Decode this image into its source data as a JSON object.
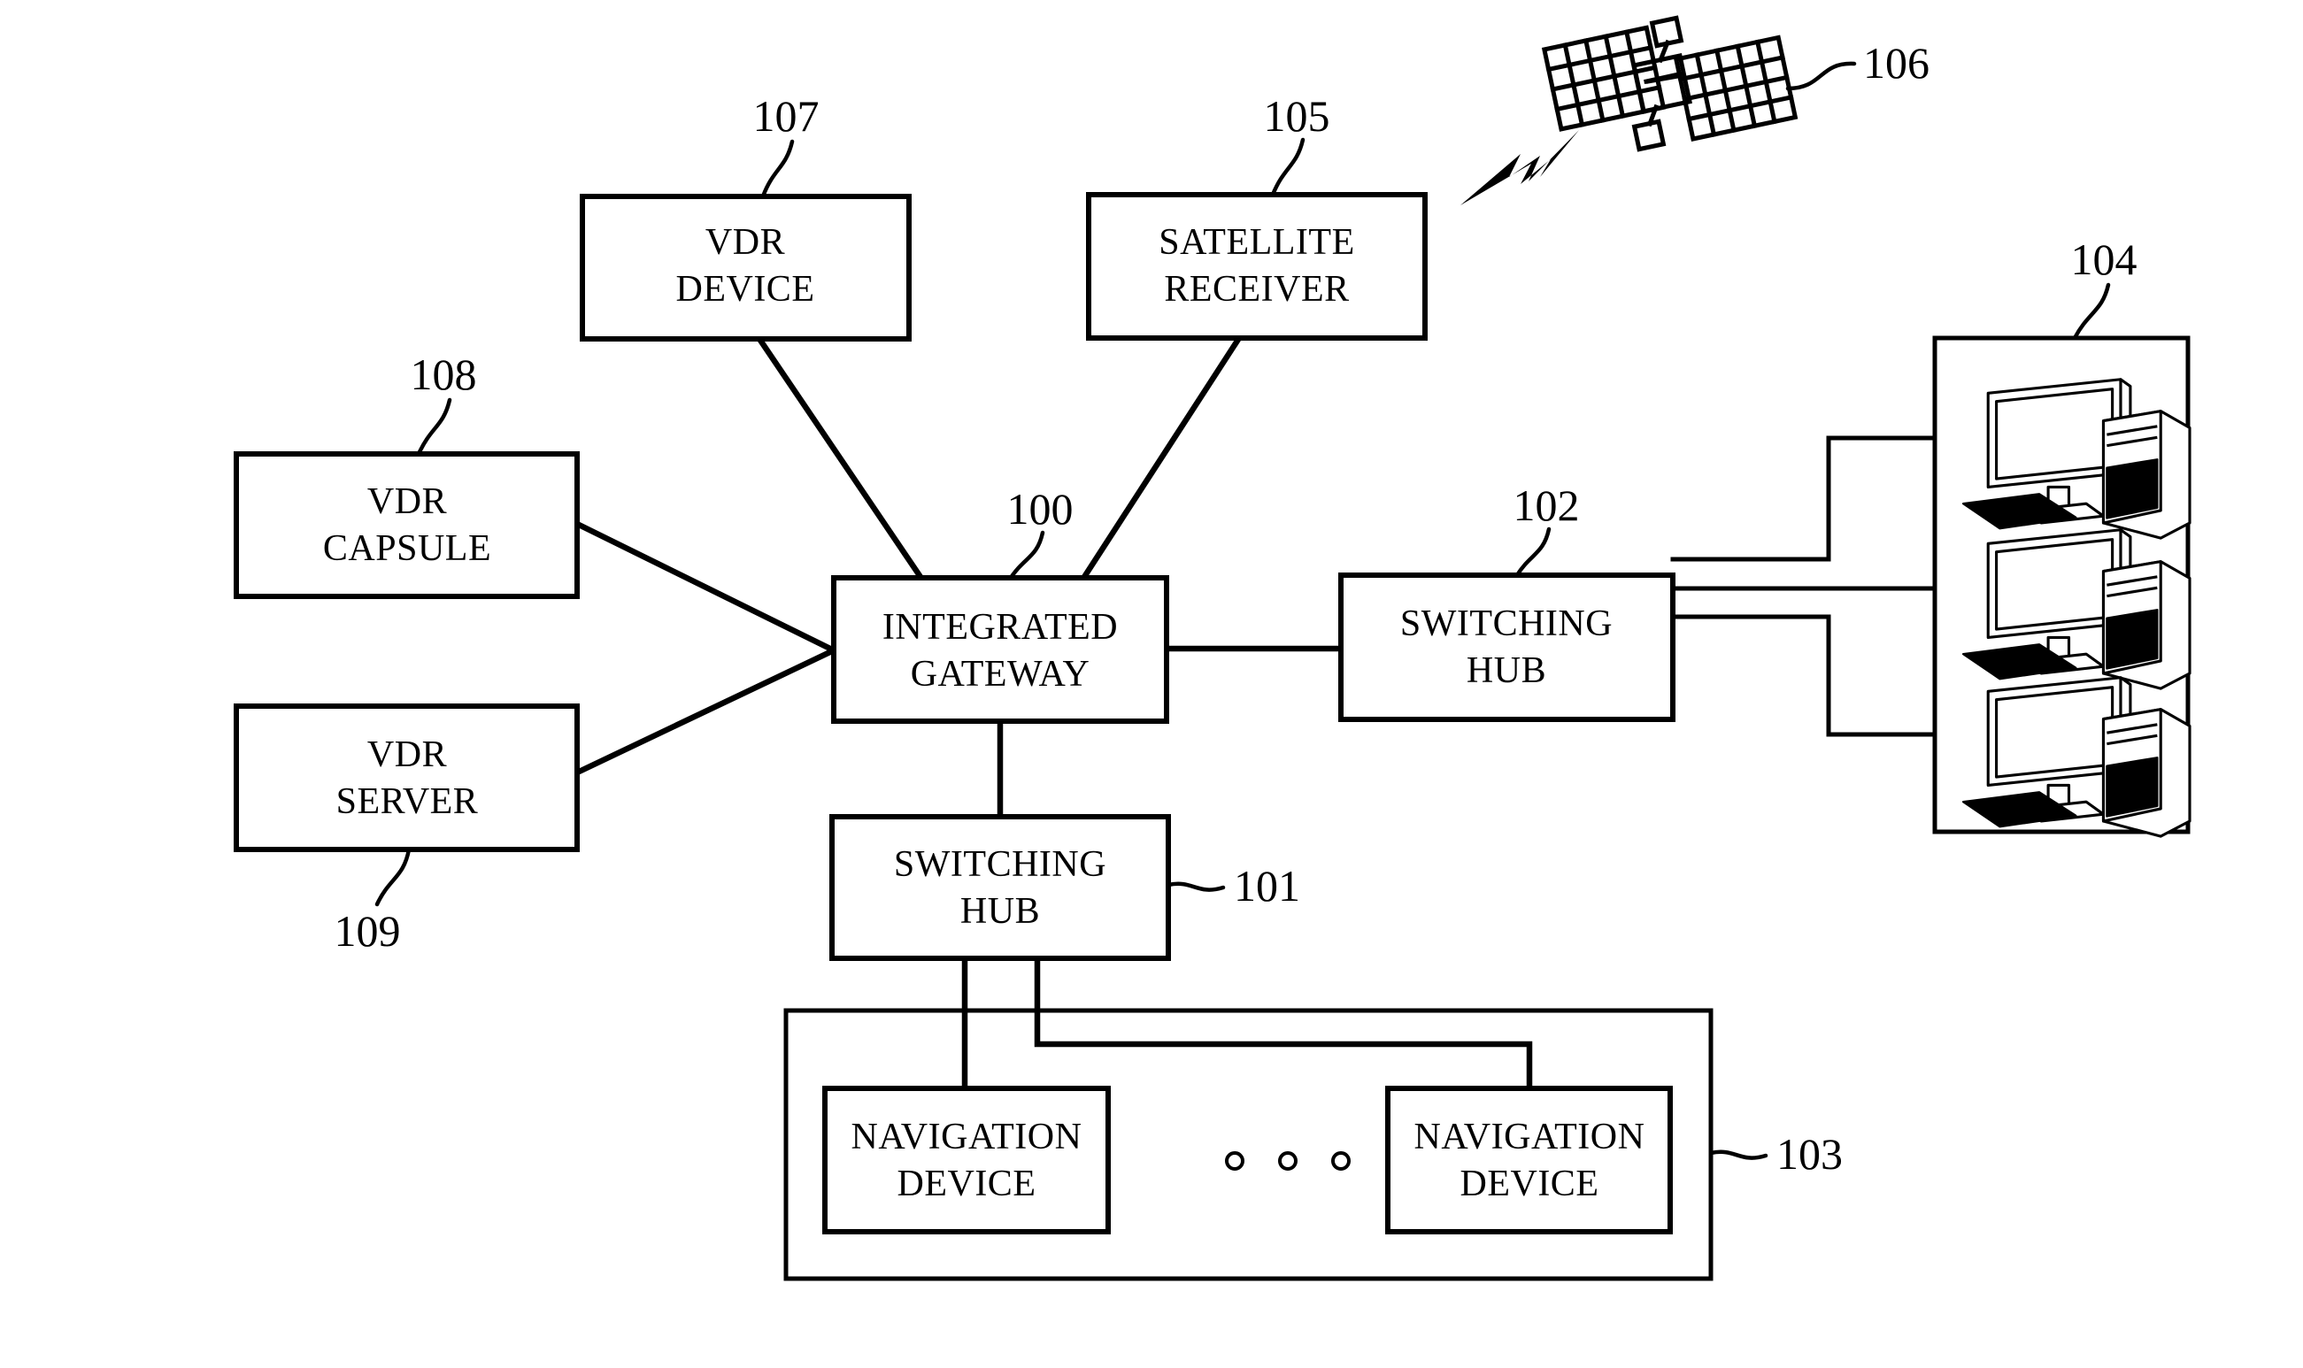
{
  "figure": {
    "type": "patent-block-diagram",
    "background_color": "#ffffff",
    "line_color": "#000000"
  },
  "blocks": {
    "vdr_device": {
      "line1": "VDR",
      "line2": "DEVICE",
      "ref": "107"
    },
    "satellite_receiver": {
      "line1": "SATELLITE",
      "line2": "RECEIVER",
      "ref": "105"
    },
    "vdr_capsule": {
      "line1": "VDR",
      "line2": "CAPSULE",
      "ref": "108"
    },
    "vdr_server": {
      "line1": "VDR",
      "line2": "SERVER",
      "ref": "109"
    },
    "integrated_gateway": {
      "line1": "INTEGRATED",
      "line2": "GATEWAY",
      "ref": "100"
    },
    "switching_hub_right": {
      "line1": "SWITCHING",
      "line2": "HUB",
      "ref": "102"
    },
    "switching_hub_bottom": {
      "line1": "SWITCHING",
      "line2": "HUB",
      "ref": "101"
    },
    "navigation_device_left": {
      "line1": "NAVIGATION",
      "line2": "DEVICE"
    },
    "navigation_device_right": {
      "line1": "NAVIGATION",
      "line2": "DEVICE"
    },
    "navigation_group": {
      "ref": "103"
    },
    "terminal_group": {
      "ref": "104"
    },
    "satellite": {
      "ref": "106",
      "icon": "satellite-icon"
    }
  },
  "icons": {
    "satellite": "satellite-icon",
    "lightning": "lightning-bolt-icon",
    "computer_1": "desktop-computer-icon",
    "computer_2": "desktop-computer-icon",
    "computer_3": "desktop-computer-icon",
    "ellipsis": "ellipsis-dots-icon"
  },
  "ellipsis": {
    "count": 3
  }
}
